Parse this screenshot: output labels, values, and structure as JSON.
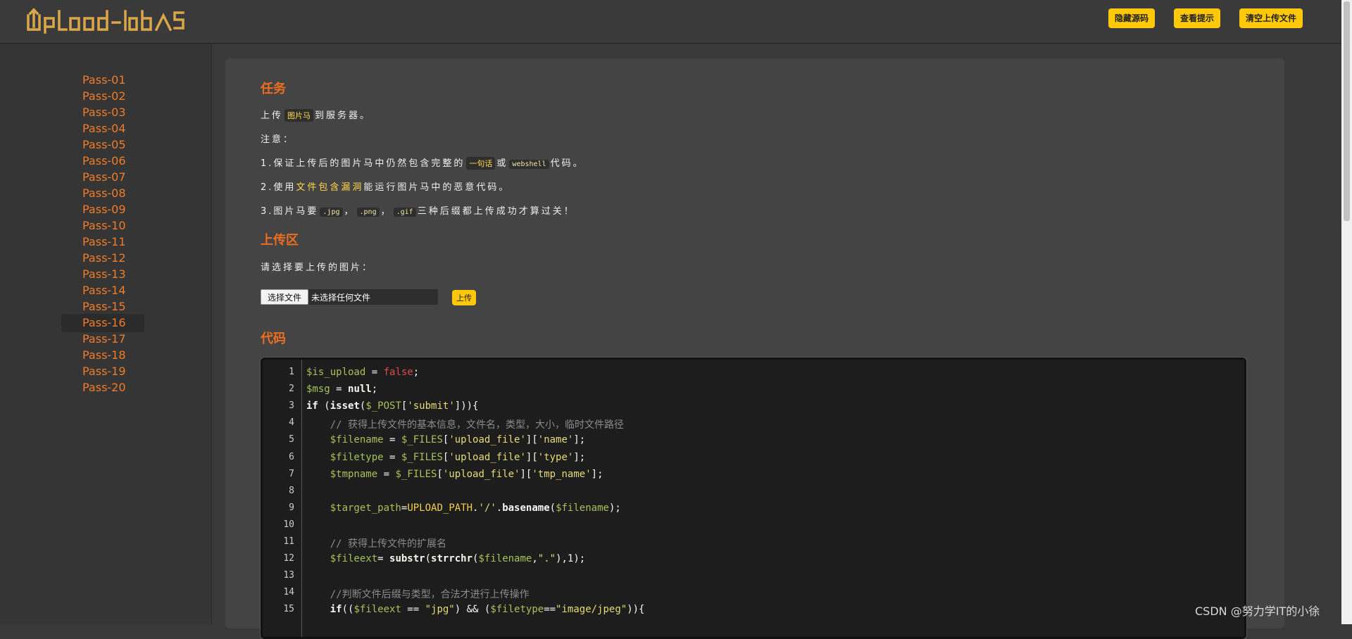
{
  "header": {
    "logo_text": "UpLoad-labS",
    "buttons": [
      "隐藏源码",
      "查看提示",
      "清空上传文件"
    ]
  },
  "sidebar": {
    "items": [
      "Pass-01",
      "Pass-02",
      "Pass-03",
      "Pass-04",
      "Pass-05",
      "Pass-06",
      "Pass-07",
      "Pass-08",
      "Pass-09",
      "Pass-10",
      "Pass-11",
      "Pass-12",
      "Pass-13",
      "Pass-14",
      "Pass-15",
      "Pass-16",
      "Pass-17",
      "Pass-18",
      "Pass-19",
      "Pass-20"
    ],
    "active": "Pass-16"
  },
  "task": {
    "title": "任务",
    "line1_pre": "上传",
    "line1_tag": "图片马",
    "line1_post": "到服务器。",
    "note": "注意：",
    "item1_pre": "1.保证上传后的图片马中仍然包含完整的",
    "item1_tag1": "一句话",
    "item1_mid": "或",
    "item1_tag2": "webshell",
    "item1_post": "代码。",
    "item2_pre": "2.使用",
    "item2_hl": "文件包含漏洞",
    "item2_post": "能运行图片马中的恶意代码。",
    "item3_pre": "3.图片马要",
    "item3_tag1": ".jpg",
    "item3_sep1": "，",
    "item3_tag2": ".png",
    "item3_sep2": "，",
    "item3_tag3": ".gif",
    "item3_post": "三种后缀都上传成功才算过关！"
  },
  "upload": {
    "title": "上传区",
    "prompt": "请选择要上传的图片：",
    "choose_label": "选择文件",
    "file_status": "未选择任何文件",
    "submit_label": "上传"
  },
  "code": {
    "title": "代码",
    "line_numbers": [
      "1",
      "2",
      "3",
      "4",
      "5",
      "6",
      "7",
      "8",
      "9",
      "10",
      "11",
      "12",
      "13",
      "14",
      "15"
    ],
    "lines": [
      "$is_upload = false;",
      "$msg = null;",
      "if (isset($_POST['submit'])){",
      "    // 获得上传文件的基本信息，文件名，类型，大小，临时文件路径",
      "    $filename = $_FILES['upload_file']['name'];",
      "    $filetype = $_FILES['upload_file']['type'];",
      "    $tmpname = $_FILES['upload_file']['tmp_name'];",
      "",
      "    $target_path=UPLOAD_PATH.'/'.basename($filename);",
      "",
      "    // 获得上传文件的扩展名",
      "    $fileext= substr(strrchr($filename,\".\"),1);",
      "",
      "    //判断文件后缀与类型，合法才进行上传操作",
      "    if(($fileext == \"jpg\") && ($filetype==\"image/jpeg\")){"
    ]
  },
  "watermark": "CSDN @努力学IT的小徐",
  "colors": {
    "accent": "#ffc80a",
    "heading": "#ef6d20",
    "sidebar_link": "#f07c28",
    "background": "#393939"
  }
}
